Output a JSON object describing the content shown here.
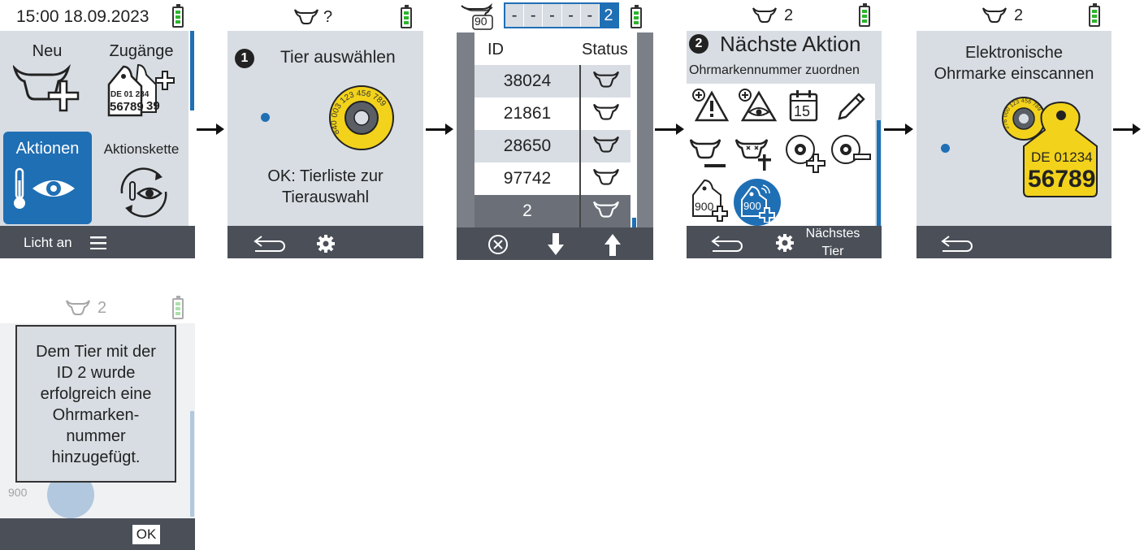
{
  "colors": {
    "screen_bg": "#d8dde3",
    "footer_bg": "#4a4f58",
    "accent": "#1f6fb5",
    "tag_yellow": "#f2d21b",
    "battery_green": "#2db52d"
  },
  "screen1": {
    "datetime": "15:00 18.09.2023",
    "tiles": [
      "Neu",
      "Zugänge",
      "Aktionen",
      "Aktionskette"
    ],
    "tag_country": "DE 01 234",
    "tag_number": "56789",
    "tag_partial": "39",
    "footer_label": "Licht an",
    "footer_icon": "hamburger-menu-icon"
  },
  "screen2": {
    "animal_id": "?",
    "step": "1",
    "title": "Tier auswählen",
    "tag_ring_text": "840 003 123 456 789",
    "hint_line1": "OK: Tierliste zur",
    "hint_line2": "Tierauswahl",
    "footer_icons": [
      "back-icon",
      "gear-icon"
    ]
  },
  "screen3": {
    "herd_count": "90",
    "id_digits": [
      "-",
      "-",
      "-",
      "-",
      "-",
      "2"
    ],
    "col_id": "ID",
    "col_status": "Status",
    "rows": [
      {
        "id": "38024"
      },
      {
        "id": "21861"
      },
      {
        "id": "28650"
      },
      {
        "id": "97742"
      },
      {
        "id": "2"
      }
    ],
    "footer_icons": [
      "cancel-circle-icon",
      "arrow-down-icon",
      "arrow-up-icon"
    ]
  },
  "screen4": {
    "animal_id": "2",
    "step": "2",
    "title": "Nächste Aktion",
    "subtitle": "Ohrmarkennummer zuordnen",
    "action_icons": [
      "add-warning-icon",
      "add-observation-icon",
      "calendar-icon",
      "pencil-icon",
      "remove-animal-icon",
      "animal-death-icon",
      "add-electronic-tag-icon",
      "remove-electronic-tag-icon",
      "add-ear-tag-icon",
      "add-electronic-ear-tag-icon"
    ],
    "calendar_day": "15",
    "tag_label": "900",
    "footer_next_line1": "Nächstes",
    "footer_next_line2": "Tier",
    "footer_icons": [
      "back-icon",
      "gear-icon"
    ]
  },
  "screen5": {
    "animal_id": "2",
    "title_line1": "Elektronische",
    "title_line2": "Ohrmarke einscannen",
    "tag_ring_text": "276 000 123 456 789",
    "tag_country": "DE 01234",
    "tag_number": "56789",
    "footer_icons": [
      "back-icon"
    ]
  },
  "screen6": {
    "animal_id": "2",
    "message_lines": [
      "Dem Tier mit der",
      "ID 2 wurde",
      "erfolgreich eine",
      "Ohrmarken-",
      "nummer",
      "hinzugefügt."
    ],
    "ok_label": "OK",
    "tag_label": "900"
  }
}
